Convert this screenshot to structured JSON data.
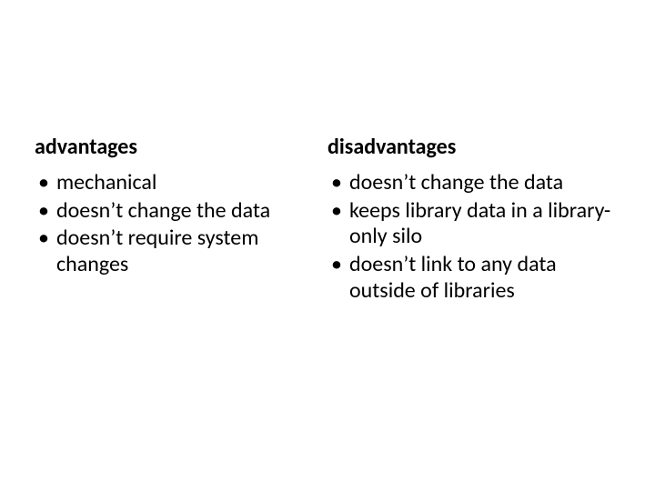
{
  "left": {
    "title": "advantages",
    "items": [
      "mechanical",
      "doesn’t change the data",
      "doesn’t require system changes"
    ]
  },
  "right": {
    "title": "disadvantages",
    "items": [
      "doesn’t change the data",
      "keeps library data in a library-only silo",
      "doesn’t link to any data outside of libraries"
    ]
  }
}
